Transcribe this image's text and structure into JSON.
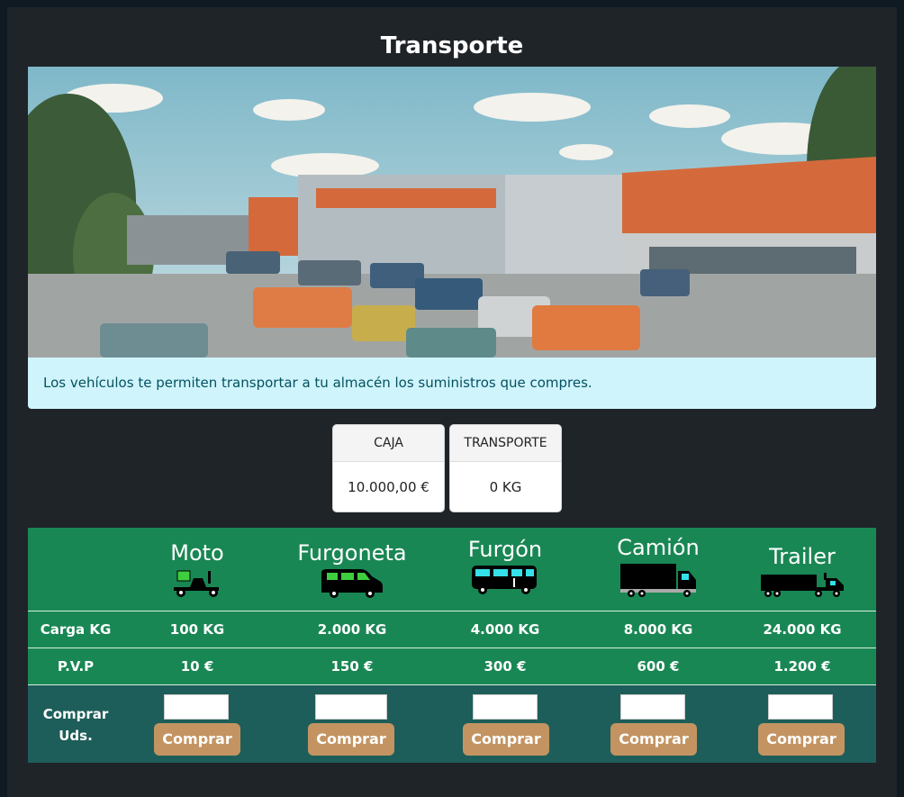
{
  "page": {
    "title": "Transporte"
  },
  "info": {
    "text": "Los vehículos te permiten transportar a tu almacén los suministros que compres."
  },
  "stats": [
    {
      "label": "CAJA",
      "value": "10.000,00 €"
    },
    {
      "label": "TRANSPORTE",
      "value": "0 KG"
    }
  ],
  "table": {
    "row_labels": {
      "carga": "Carga KG",
      "pvp": "P.V.P",
      "comprar": "Comprar Uds."
    },
    "vehicles": [
      {
        "name": "Moto",
        "icon": "scooter-icon",
        "carga": "100 KG",
        "pvp": "10 €",
        "buy": "Comprar"
      },
      {
        "name": "Furgoneta",
        "icon": "van-icon",
        "carga": "2.000 KG",
        "pvp": "150 €",
        "buy": "Comprar"
      },
      {
        "name": "Furgón",
        "icon": "minibus-icon",
        "carga": "4.000 KG",
        "pvp": "300 €",
        "buy": "Comprar"
      },
      {
        "name": "Camión",
        "icon": "truck-icon",
        "carga": "8.000 KG",
        "pvp": "600 €",
        "buy": "Comprar"
      },
      {
        "name": "Trailer",
        "icon": "trailer-icon",
        "carga": "24.000 KG",
        "pvp": "1.200 €",
        "buy": "Comprar"
      }
    ]
  },
  "colors": {
    "table_bg": "#198754",
    "buy_row_bg": "#1e5e5a",
    "button": "#c39462",
    "info_bg": "#cff4fc"
  }
}
